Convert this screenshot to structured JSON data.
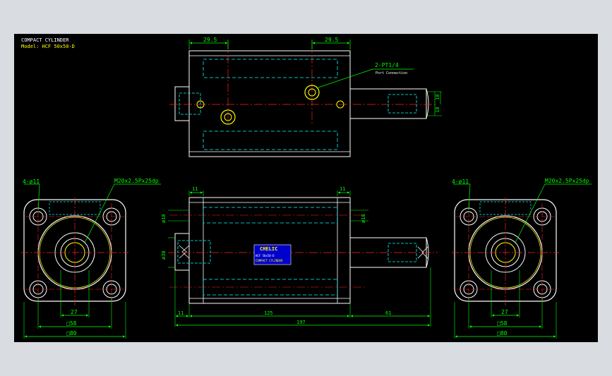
{
  "title": {
    "line1": "COMPACT CYLINDER",
    "line2": "Model: HCF 50x50-D"
  },
  "colors": {
    "background": "#000000",
    "frame": "#d9dce0",
    "outline": "#ffffff",
    "dimension": "#00ff00",
    "hidden": "#00ffff",
    "center": "#ff2020",
    "port": "#ffff00",
    "plate": "#0000cc"
  },
  "top_view": {
    "dim_left": "29.5",
    "dim_right": "29.5",
    "port_label": "2-PT1/4",
    "port_sub": "Port Connection",
    "dim_side_a": "10",
    "dim_side_b": "10"
  },
  "left_view": {
    "hole_label": "4-ø11",
    "thread_label": "M20x2.5Px25dp",
    "dim_27": "27",
    "dim_58": "□58",
    "dim_80": "□80"
  },
  "front_view": {
    "dim_top_left": "11",
    "dim_top_right": "11",
    "dia_left": "ø18",
    "dia_right": "ø18",
    "dia_rod": "ø30",
    "dim_11": "11",
    "dim_125": "125",
    "dim_61": "61",
    "dim_197": "197",
    "plate_brand": "CHELIC",
    "plate_line1": "HCF 50x50-D",
    "plate_line2": "COMPACT CYLINDER"
  },
  "right_view": {
    "hole_label": "4-ø11",
    "thread_label": "M20x2.5Px25dp",
    "dim_27": "27",
    "dim_58": "□58",
    "dim_80": "□80"
  }
}
